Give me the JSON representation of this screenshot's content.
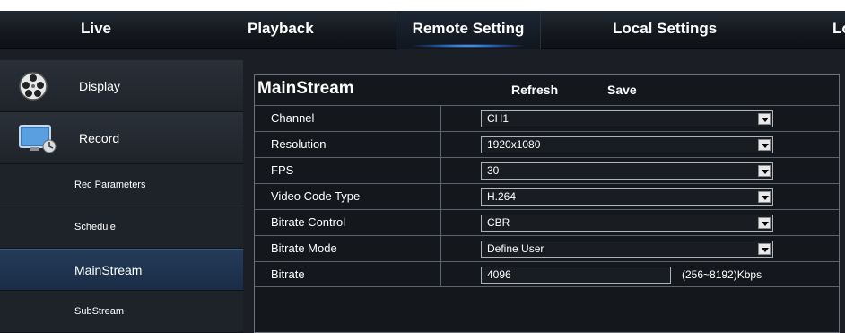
{
  "nav": {
    "live": "Live",
    "playback": "Playback",
    "remote_setting": "Remote Setting",
    "local_settings": "Local Settings",
    "partial": "Lo"
  },
  "sidebar": {
    "display": "Display",
    "record": "Record",
    "rec_parameters": "Rec Parameters",
    "schedule": "Schedule",
    "mainstream": "MainStream",
    "substream": "SubStream"
  },
  "panel": {
    "title": "MainStream",
    "refresh": "Refresh",
    "save": "Save"
  },
  "rows": {
    "channel": {
      "label": "Channel",
      "value": "CH1"
    },
    "resolution": {
      "label": "Resolution",
      "value": "1920x1080"
    },
    "fps": {
      "label": "FPS",
      "value": "30"
    },
    "video_code_type": {
      "label": "Video Code Type",
      "value": "H.264"
    },
    "bitrate_control": {
      "label": "Bitrate Control",
      "value": "CBR"
    },
    "bitrate_mode": {
      "label": "Bitrate Mode",
      "value": "Define User"
    },
    "bitrate": {
      "label": "Bitrate",
      "value": "4096",
      "range": "(256~8192)Kbps"
    }
  },
  "colors": {
    "accent_glow": "#5fb4ff",
    "selected_bg": "#243b58",
    "panel_border": "#6b727c"
  }
}
